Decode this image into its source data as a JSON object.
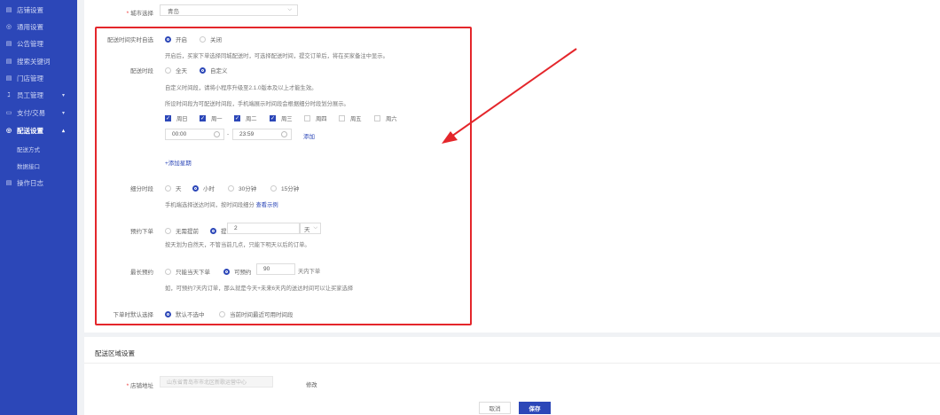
{
  "sidebar": {
    "items": [
      {
        "icon": "shop-icon",
        "glyph": "▤",
        "label": "店铺设置"
      },
      {
        "icon": "settings-icon",
        "glyph": "◎",
        "label": "通用设置"
      },
      {
        "icon": "notice-icon",
        "glyph": "▤",
        "label": "公告管理"
      },
      {
        "icon": "search-icon",
        "glyph": "▤",
        "label": "搜索关键词"
      },
      {
        "icon": "store-icon",
        "glyph": "▤",
        "label": "门店管理"
      },
      {
        "icon": "staff-icon",
        "glyph": "ℷ",
        "label": "员工管理"
      },
      {
        "icon": "payment-icon",
        "glyph": "▭",
        "label": "支付/交易"
      },
      {
        "icon": "delivery-icon",
        "glyph": "◎",
        "label": "配送设置"
      },
      {
        "icon": "log-icon",
        "glyph": "▤",
        "label": "操作日志"
      }
    ],
    "sub": [
      "配送方式",
      "数据接口"
    ]
  },
  "form": {
    "city": {
      "label": "城市选择",
      "value": "青岛"
    },
    "realtime": {
      "label": "配送时间实时自选",
      "on": "开启",
      "off": "关闭",
      "hint": "开启后，买家下单选择同城配送时，可选择配送时间，提交订单后，将在买家备注中显示。"
    },
    "period": {
      "label": "配送时段",
      "all": "全天",
      "custom": "自定义",
      "hint1": "自定义时间段，请将小程序升级至2.1.0版本及以上才能生效。",
      "hint2": "所设时间段为可配送时间段，手机端展示时间段会根据细分时段划分展示。"
    },
    "days": [
      "周日",
      "周一",
      "周二",
      "周三",
      "周四",
      "周五",
      "周六"
    ],
    "time_start": "00:00",
    "time_end": "23:59",
    "add": "添加",
    "add_week": "+添加星期",
    "split": {
      "label": "细分时段",
      "opts": [
        "天",
        "小时",
        "30分钟",
        "15分钟"
      ],
      "hint": "手机端选择送达时间，按时间段细分",
      "hint_link": "查看示例"
    },
    "reserve": {
      "label": "预约下单",
      "opt1": "无需提前",
      "opt2": "提前",
      "value": "2",
      "unit": "天",
      "hint": "按天划为自然天，不管当前几点，只能下明天以后的订单。"
    },
    "longest": {
      "label": "最长预约",
      "opt1": "只能当天下单",
      "opt2": "可预约",
      "value": "90",
      "suffix": "天内下单",
      "hint": "如，可预约7天内订单，那么就是今天+未来6天内的送达时间可以让买家选择"
    },
    "default": {
      "label": "下单时默认选择",
      "opt1": "默认不选中",
      "opt2": "当前时间最近可用时间段"
    }
  },
  "area": {
    "title": "配送区域设置",
    "addr_label": "店铺地址",
    "addr_placeholder": "山东省青岛市市北区新歌运营中心",
    "edit": "修改"
  },
  "buttons": {
    "cancel": "取消",
    "save": "保存"
  },
  "colors": {
    "sidebar": "#2c47b8",
    "accent": "#2c47b8",
    "highlight": "#e4262b"
  }
}
